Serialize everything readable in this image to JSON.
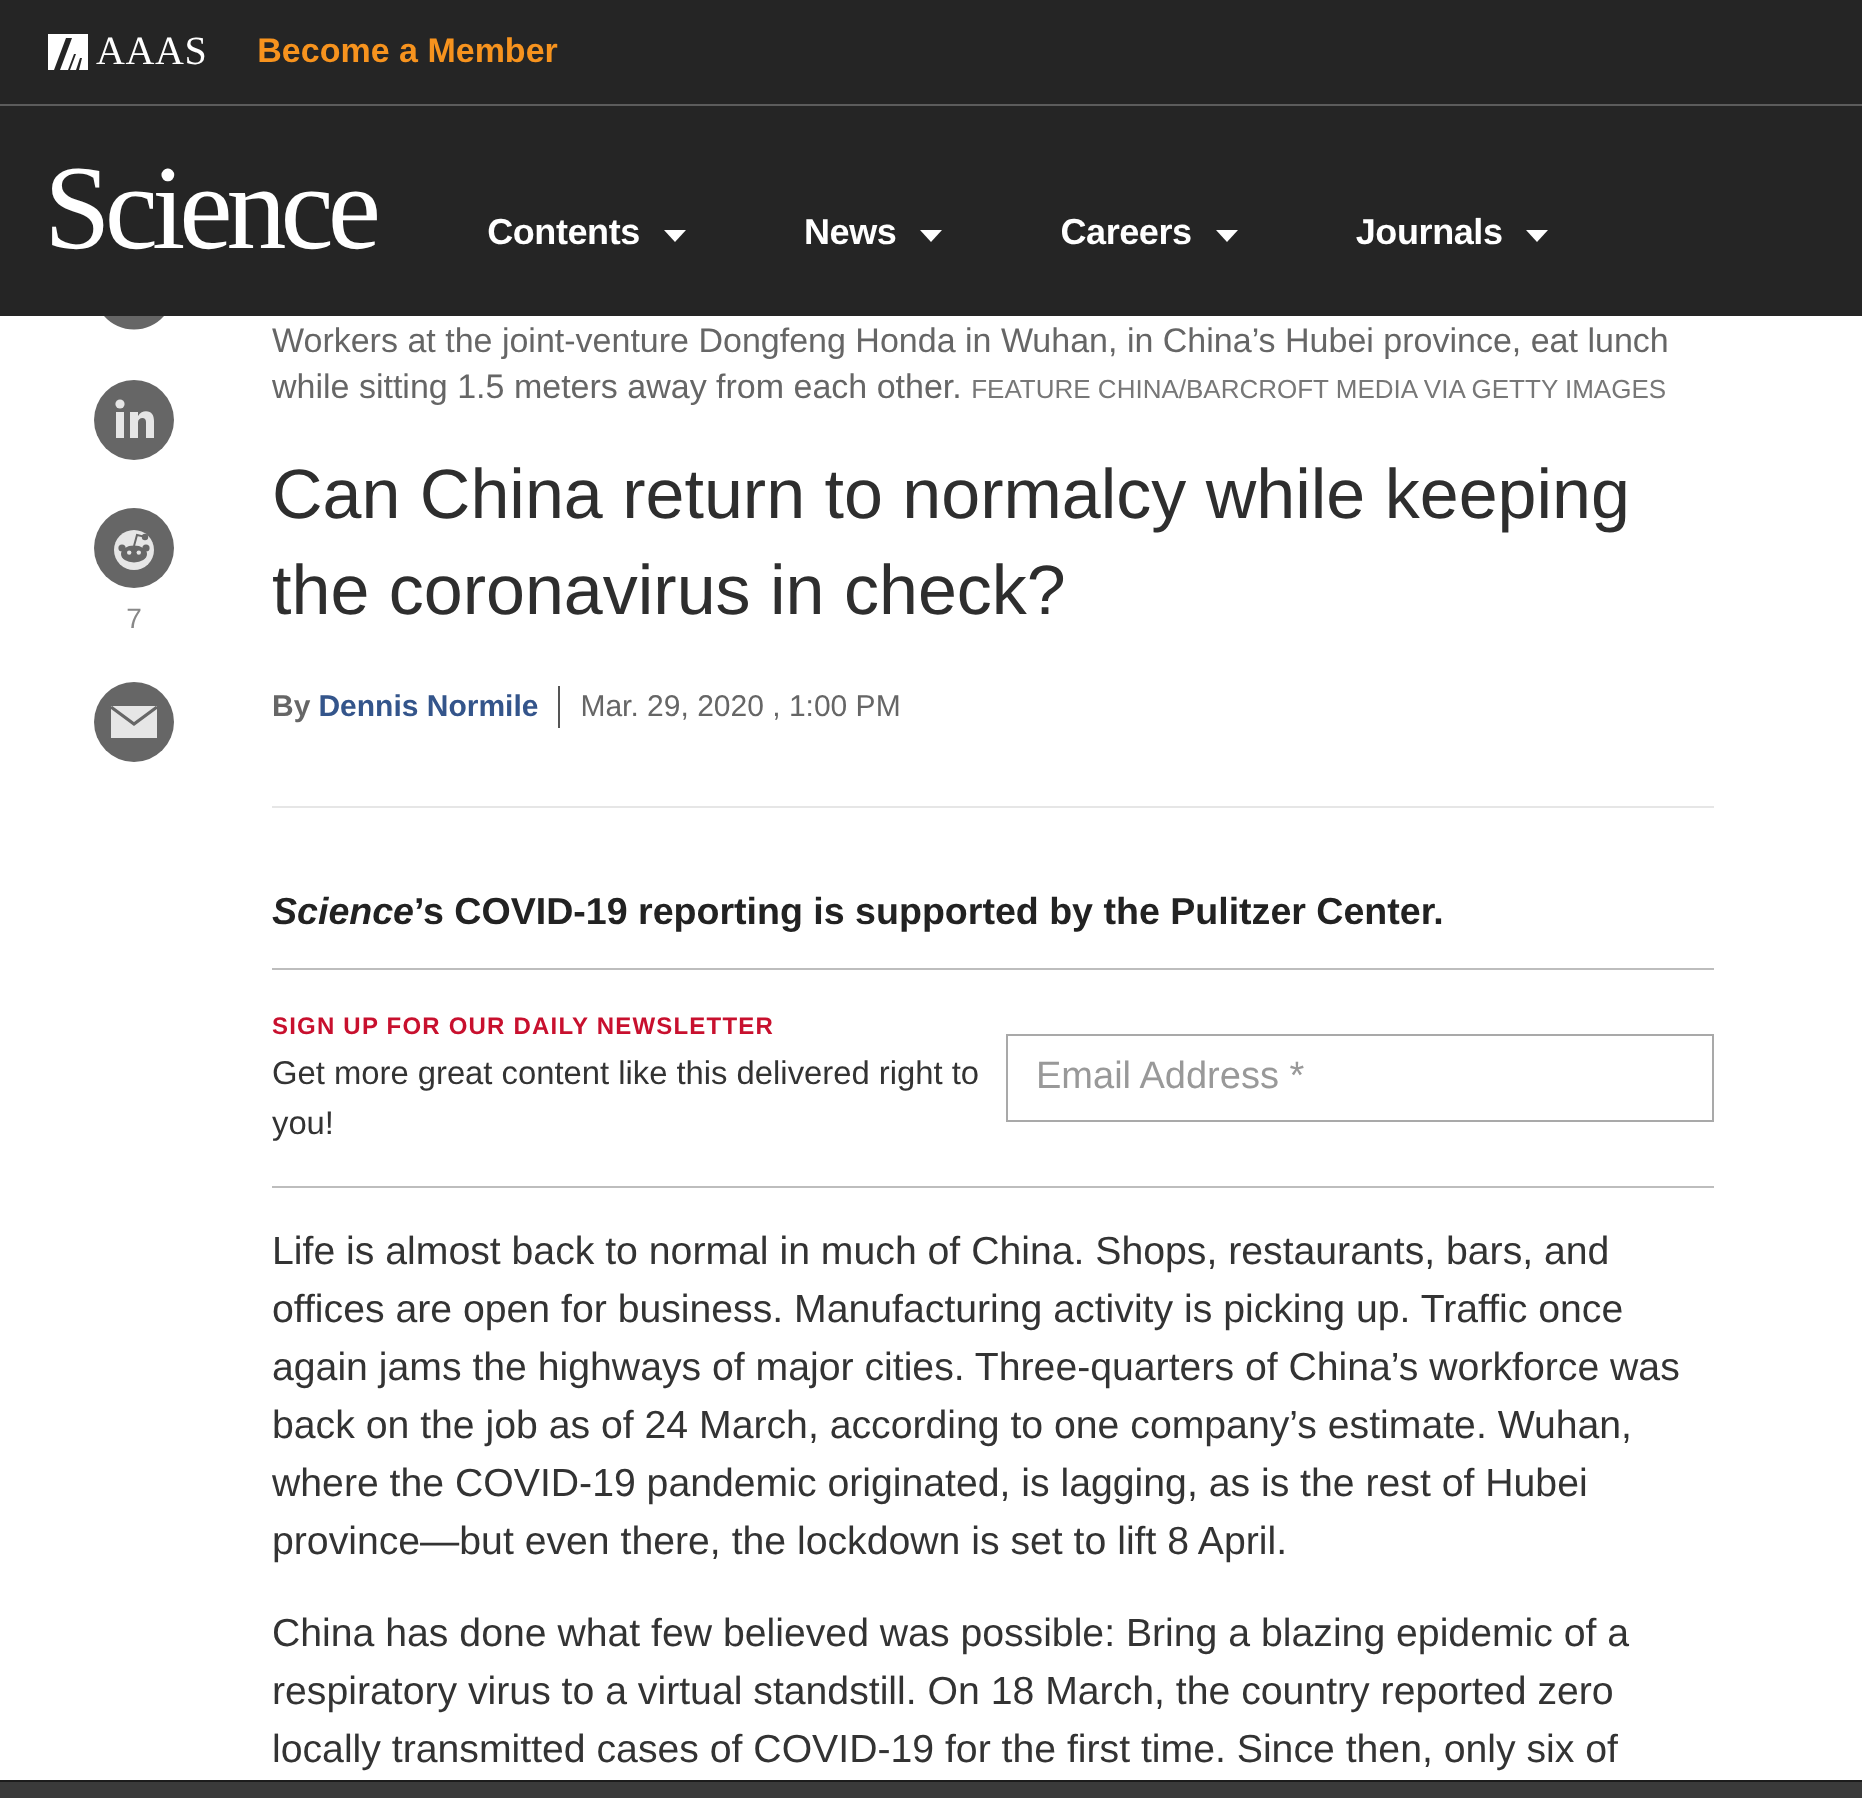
{
  "top_bar": {
    "logo": "AAAS",
    "member_link": "Become a Member"
  },
  "nav": {
    "logo": "Science",
    "items": [
      "Contents",
      "News",
      "Careers",
      "Journals"
    ]
  },
  "share": {
    "count": "7"
  },
  "article": {
    "caption": "Workers at the joint-venture Dongfeng Honda in Wuhan, in China’s Hubei province, eat lunch while sitting 1.5 meters away from each other.",
    "credit": "FEATURE CHINA/BARCROFT MEDIA VIA GETTY IMAGES",
    "title": "Can China return to normalcy while keeping the coronavirus in check?",
    "byline": {
      "prefix": "By",
      "author": "Dennis Normile",
      "date": "Mar. 29, 2020 , 1:00 PM"
    },
    "support_note": "*Science*’s COVID-19 reporting is supported by the Pulitzer Center.",
    "newsletter": {
      "heading": "SIGN UP FOR OUR DAILY NEWSLETTER",
      "description": "Get more great content like this delivered right to you!",
      "email_field": {
        "placeholder": "Email Address *"
      }
    },
    "paragraphs": [
      "Life is almost back to normal in much of China. Shops, restaurants, bars, and offices are open for business. Manufacturing activity is picking up. Traffic once again jams the highways of major cities. Three-quarters of China’s workforce was back on the job as of 24 March, according to one company’s estimate. Wuhan, where the COVID-19 pandemic originated, is lagging, as is the rest of Hubei province—but even there, the lockdown is set to lift 8 April.",
      "China has done what few believed was possible: Bring a blazing epidemic of a respiratory virus to a virtual standstill. On 18 March, the country reported zero locally transmitted cases of COVID-19 for the first time. Since then, only six of"
    ]
  }
}
